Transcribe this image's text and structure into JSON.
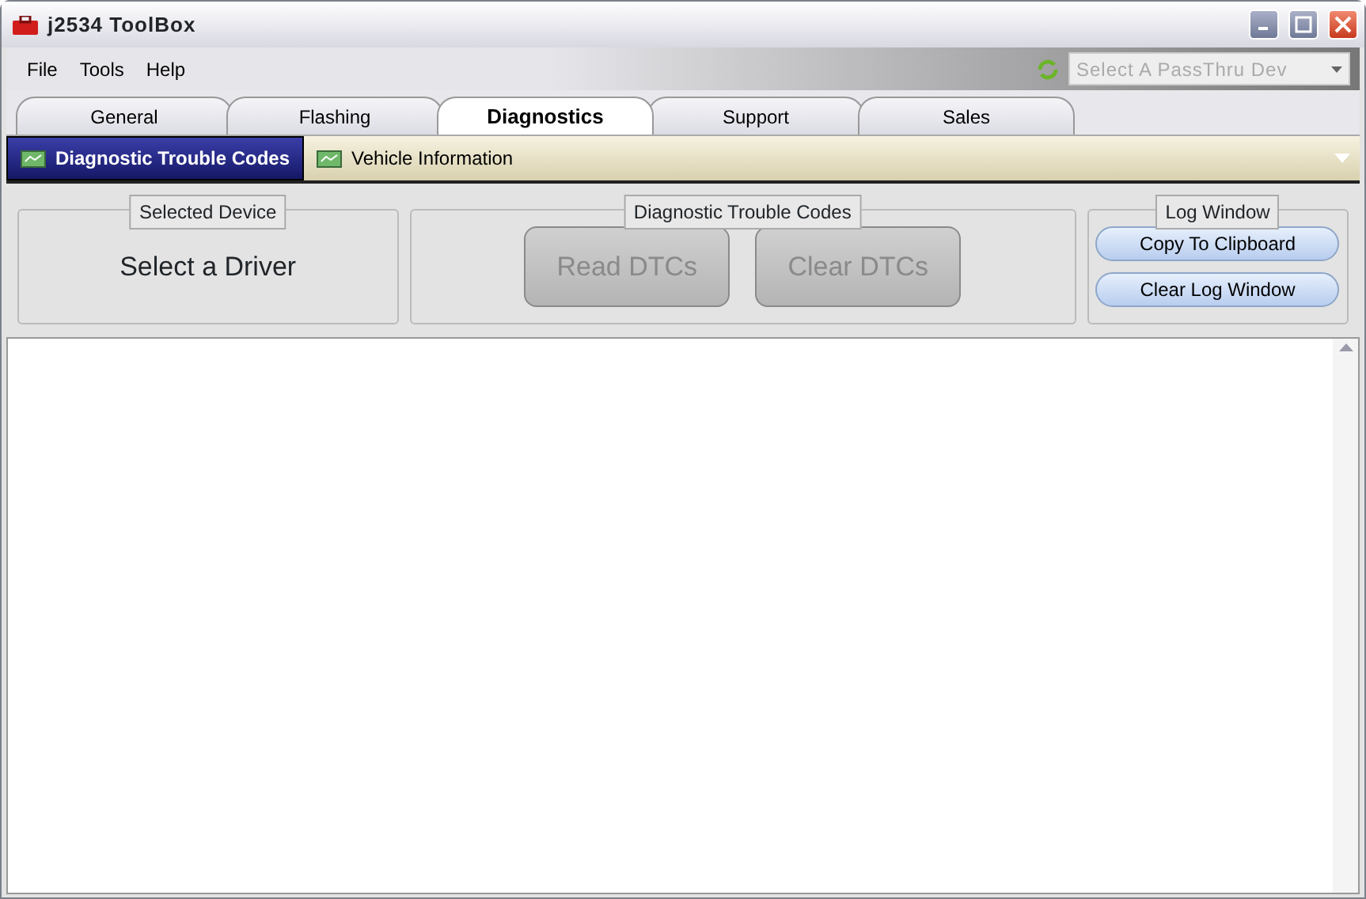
{
  "window": {
    "title": "j2534  ToolBox"
  },
  "menu": [
    "File",
    "Tools",
    "Help"
  ],
  "device_select": {
    "placeholder": "Select A PassThru Dev",
    "disabled": true
  },
  "tabs": [
    {
      "label": "General",
      "selected": false
    },
    {
      "label": "Flashing",
      "selected": false
    },
    {
      "label": "Diagnostics",
      "selected": true
    },
    {
      "label": "Support",
      "selected": false
    },
    {
      "label": "Sales",
      "selected": false
    }
  ],
  "subtabs": [
    {
      "label": "Diagnostic Trouble Codes",
      "selected": true
    },
    {
      "label": "Vehicle Information",
      "selected": false
    }
  ],
  "groups": [
    {
      "title": "Selected Device",
      "kind": "text",
      "text": "Select a Driver"
    },
    {
      "title": "Diagnostic Trouble Codes",
      "kind": "dtc",
      "buttons": [
        {
          "label": "Read DTCs",
          "disabled": true
        },
        {
          "label": "Clear DTCs",
          "disabled": true
        }
      ]
    },
    {
      "title": "Log Window",
      "kind": "log",
      "buttons": [
        {
          "label": "Copy To Clipboard",
          "disabled": false
        },
        {
          "label": "Clear Log Window",
          "disabled": false
        }
      ]
    }
  ]
}
